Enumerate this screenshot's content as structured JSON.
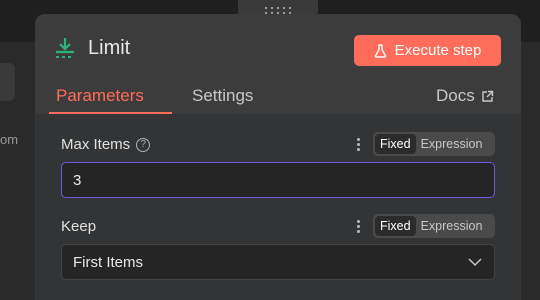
{
  "background": {
    "left_text": "om"
  },
  "node": {
    "title": "Limit",
    "icon": "download-limit-icon",
    "execute_label": "Execute step",
    "execute_icon": "flask-icon"
  },
  "tabs": [
    {
      "label": "Parameters",
      "active": true
    },
    {
      "label": "Settings",
      "active": false
    }
  ],
  "docs": {
    "label": "Docs",
    "icon": "external-link-icon"
  },
  "params": [
    {
      "label": "Max Items",
      "has_help": true,
      "help_symbol": "?",
      "mode_options": [
        "Fixed",
        "Expression"
      ],
      "mode_selected": "Fixed",
      "value": "3"
    },
    {
      "label": "Keep",
      "has_help": false,
      "mode_options": [
        "Fixed",
        "Expression"
      ],
      "mode_selected": "Fixed",
      "value": "First Items"
    }
  ],
  "colors": {
    "accent": "#ff6d5a",
    "focus_border": "#6b5bd6",
    "icon_green": "#2cb57a"
  }
}
